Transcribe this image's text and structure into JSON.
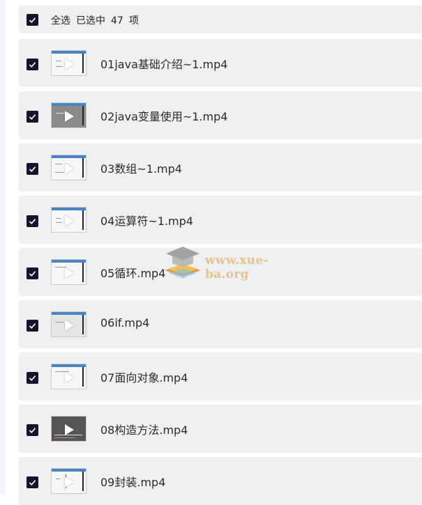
{
  "header": {
    "select_all": "全选",
    "selected_prefix": "已选中",
    "selected_count": "47",
    "selected_suffix": "项"
  },
  "files": [
    {
      "name": "01java基础介绍~1.mp4"
    },
    {
      "name": "02java变量使用~1.mp4"
    },
    {
      "name": "03数组~1.mp4"
    },
    {
      "name": "04运算符~1.mp4"
    },
    {
      "name": "05循环.mp4"
    },
    {
      "name": "06if.mp4"
    },
    {
      "name": "07面向对象.mp4"
    },
    {
      "name": "08构造方法.mp4"
    },
    {
      "name": "09封装.mp4"
    }
  ],
  "watermark": {
    "text": "www.xue-ba.org"
  },
  "icons": {
    "checkbox": "checkbox-checked-icon",
    "video": "video-thumbnail-icon",
    "play": "play-icon",
    "logo": "graduation-cap-logo"
  },
  "colors": {
    "checkbox": "#14142b",
    "row_bg": "#eff0f2",
    "watermark_text": "#e5c38a"
  }
}
